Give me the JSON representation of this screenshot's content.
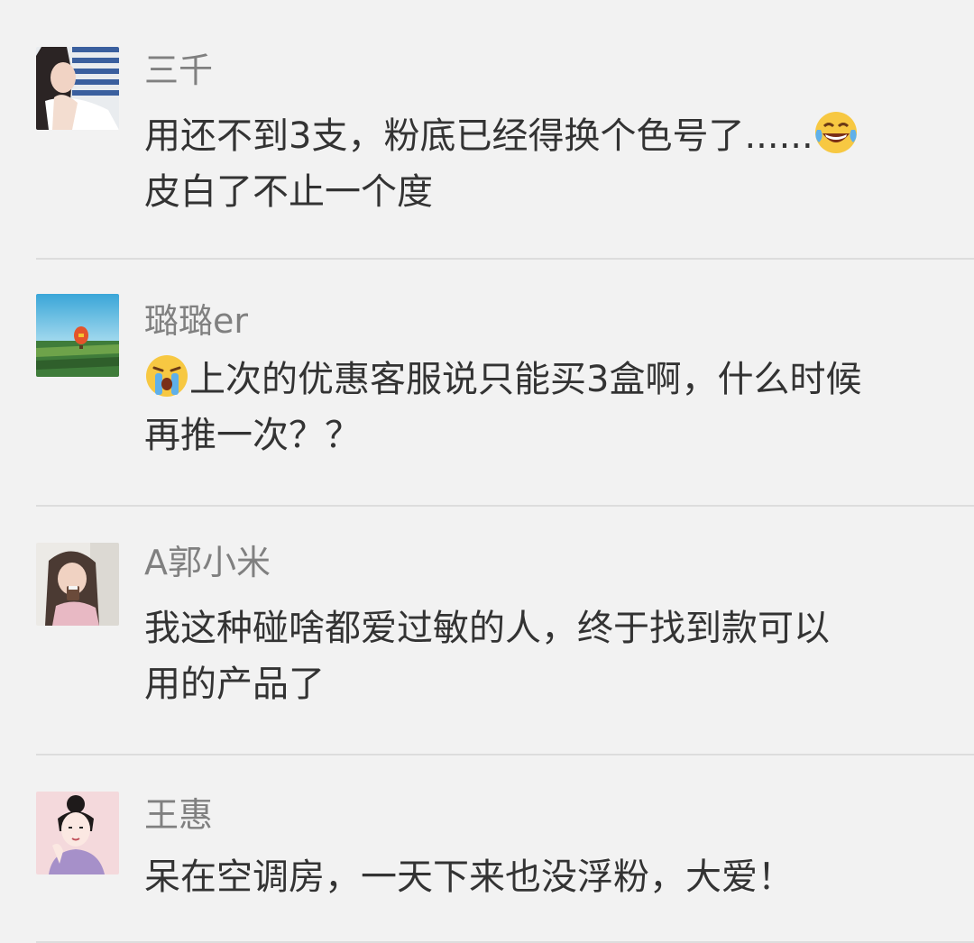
{
  "comments": [
    {
      "username": "三千",
      "avatar_icon": "avatar-girl-striped-icon",
      "line1": "用还不到3支，粉底已经得换个色号了......",
      "line1_emoji": "laughing-tears-emoji",
      "line2": "皮白了不止一个度"
    },
    {
      "username": "璐璐er",
      "avatar_icon": "avatar-hot-air-balloon-icon",
      "line1_emoji": "crying-emoji",
      "line1": "上次的优惠客服说只能买3盒啊，什么时候",
      "line2": "再推一次？？"
    },
    {
      "username": "A郭小米",
      "avatar_icon": "avatar-girl-with-cup-icon",
      "line1": "我这种碰啥都爱过敏的人，终于找到款可以",
      "line2": "用的产品了"
    },
    {
      "username": "王惠",
      "avatar_icon": "avatar-illustrated-woman-icon",
      "line1": "呆在空调房，一天下来也没浮粉，大爱！"
    }
  ],
  "colors": {
    "background": "#f2f2f2",
    "username": "#808080",
    "text": "#333333",
    "divider": "#dddddd"
  }
}
